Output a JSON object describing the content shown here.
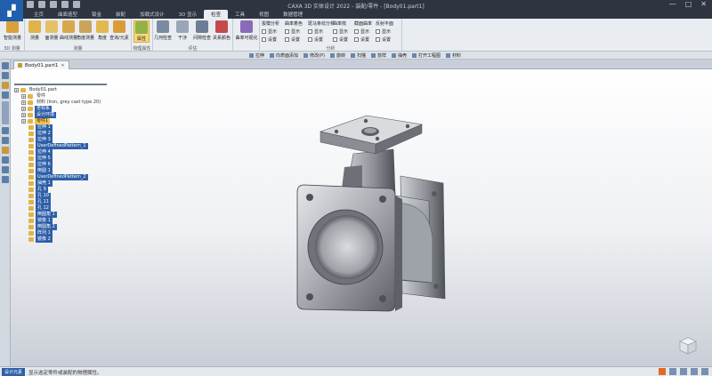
{
  "window": {
    "title": "CAXA 3D 实体设计 2022 - 装配/零件 - [Body01.part1]",
    "controls": [
      "—",
      "□",
      "✕"
    ]
  },
  "tabs": [
    {
      "label": "主页"
    },
    {
      "label": "曲面造型"
    },
    {
      "label": "钣金"
    },
    {
      "label": "装配"
    },
    {
      "label": "加载式设计"
    },
    {
      "label": "3D 显示"
    },
    {
      "label": "检查",
      "active": true
    },
    {
      "label": "工具"
    },
    {
      "label": "视图"
    },
    {
      "label": "数据管理"
    }
  ],
  "ribbon": {
    "groups": [
      {
        "label": "3D 测量",
        "buttons": [
          "智能测量"
        ]
      },
      {
        "label": "测量",
        "buttons": [
          "测量",
          "面测量",
          "曲线测量",
          "角度测量",
          "角度",
          "查询/元素"
        ]
      },
      {
        "label": "物理属性",
        "buttons": [
          "属性"
        ]
      },
      {
        "label": "评估",
        "buttons": [
          "几何检查",
          "干涉",
          "间隙检查",
          "关系颜色"
        ]
      },
      {
        "label": "",
        "buttons": [
          "曲率可视化"
        ]
      },
      {
        "label": "分析",
        "columns": [
          {
            "title": "拔模分析",
            "items": [
              "显示",
              "设置"
            ]
          },
          {
            "title": "曲率着色",
            "items": [
              "显示",
              "设置"
            ]
          },
          {
            "title": "斑马条纹分析",
            "items": [
              "显示",
              "设置"
            ]
          },
          {
            "title": "曲率梳",
            "items": [
              "显示",
              "设置"
            ]
          },
          {
            "title": "截面曲率",
            "items": [
              "显示",
              "设置"
            ]
          },
          {
            "title": "反射平面",
            "items": [
              "显示",
              "设置"
            ]
          }
        ]
      }
    ]
  },
  "toolbar2": [
    "拉伸",
    "向表面添加",
    "修改(P)",
    "旋转",
    "扫描",
    "放样",
    "抽壳",
    "打开工程图",
    "材料"
  ],
  "document": {
    "tab": "Body01.part1"
  },
  "tree": [
    {
      "label": "Body01.part",
      "level": 0,
      "style": "plain"
    },
    {
      "label": "零件",
      "level": 1,
      "style": "plain"
    },
    {
      "label": "材料 (Iron, grey cast type 20)",
      "level": 1,
      "style": "plain"
    },
    {
      "label": "坐标系",
      "level": 1
    },
    {
      "label": "设计环境",
      "level": 1
    },
    {
      "label": "零件1",
      "level": 1,
      "style": "hl"
    },
    {
      "label": "拉伸 1",
      "level": 2
    },
    {
      "label": "拉伸 2",
      "level": 2
    },
    {
      "label": "拉伸 3",
      "level": 2
    },
    {
      "label": "UserDefinedPattern_1",
      "level": 2
    },
    {
      "label": "拉伸 4",
      "level": 2
    },
    {
      "label": "拉伸 5",
      "level": 2
    },
    {
      "label": "拉伸 6",
      "level": 2
    },
    {
      "label": "倒圆 1",
      "level": 2
    },
    {
      "label": "UserDefinedPattern_2",
      "level": 2
    },
    {
      "label": "抽壳 1",
      "level": 2
    },
    {
      "label": "孔 9",
      "level": 2
    },
    {
      "label": "孔 10",
      "level": 2
    },
    {
      "label": "孔 11",
      "level": 2
    },
    {
      "label": "孔 12",
      "level": 2
    },
    {
      "label": "倒圆角 1",
      "level": 2
    },
    {
      "label": "镜像 1",
      "level": 2
    },
    {
      "label": "倒圆角 2",
      "level": 2
    },
    {
      "label": "阵列 1",
      "level": 2
    },
    {
      "label": "镜像 2",
      "level": 2
    }
  ],
  "status": {
    "panel": "设计元素",
    "message": "显示选定零件或装配的物理属性。"
  },
  "colors": {
    "accent": "#2e5fa8",
    "highlight": "#f3c04a",
    "ribbon_bg": "#e9edf2"
  }
}
